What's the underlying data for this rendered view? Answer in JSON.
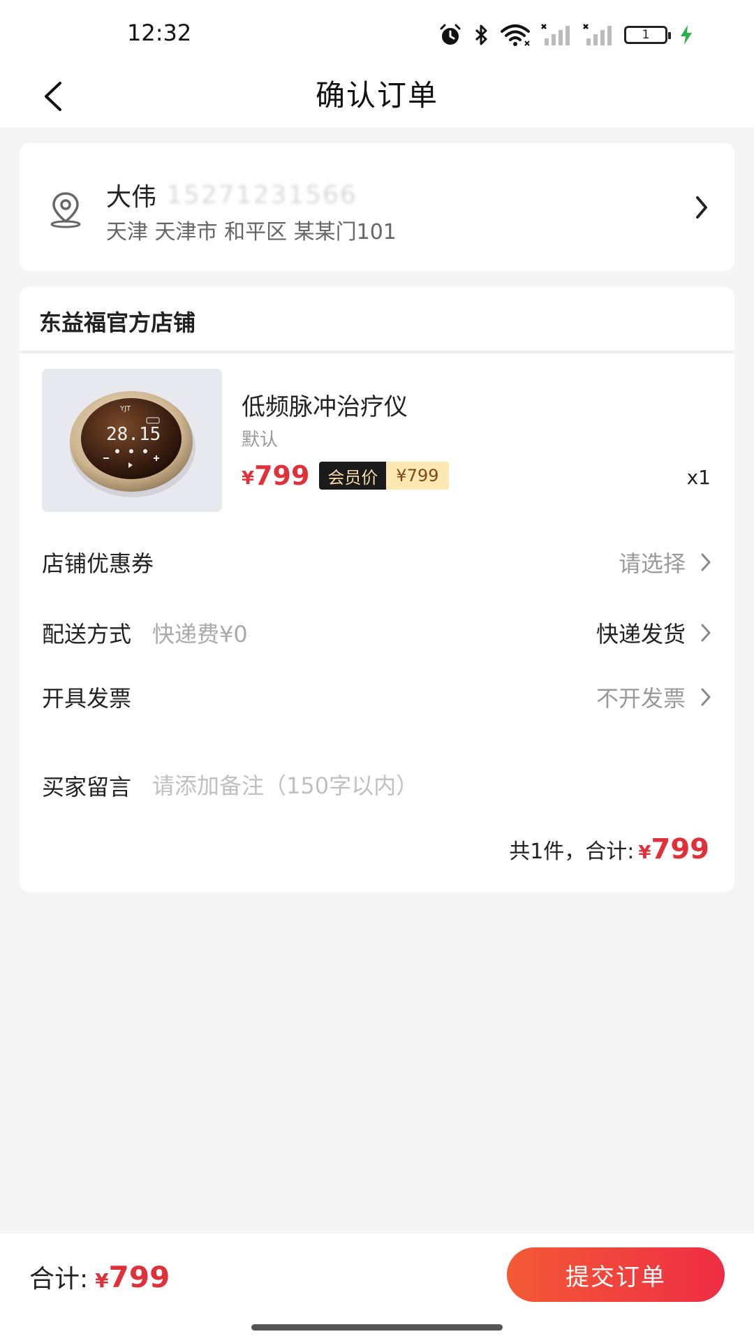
{
  "status_bar": {
    "time": "12:32",
    "battery_level": "1",
    "icons": [
      "alarm-icon",
      "bluetooth-icon",
      "wifi-icon",
      "signal-icon",
      "signal-icon",
      "battery-icon",
      "charging-icon"
    ],
    "charging_color": "#2bb24c"
  },
  "nav": {
    "title": "确认订单",
    "back_icon": "chevron-left-icon"
  },
  "address": {
    "name": "大伟",
    "phone": "15271231566",
    "detail": "天津 天津市 和平区 某某门101",
    "icon": "location-pin-icon"
  },
  "shop": {
    "name": "东益福官方店铺"
  },
  "product": {
    "image_brand": "YJT",
    "image_display": "28.15",
    "name": "低频脉冲治疗仪",
    "spec": "默认",
    "price_symbol": "¥",
    "price": "799",
    "member_label": "会员价",
    "member_price": "¥799",
    "quantity": "x1"
  },
  "rows": {
    "coupon": {
      "label": "店铺优惠券",
      "value": "请选择"
    },
    "delivery": {
      "label": "配送方式",
      "sub": "快递费¥0",
      "value": "快递发货"
    },
    "invoice": {
      "label": "开具发票",
      "value": "不开发票"
    },
    "remark": {
      "label": "买家留言",
      "placeholder": "请添加备注（150字以内）",
      "value": ""
    }
  },
  "summary": {
    "text": "共1件，合计:",
    "price_symbol": "¥",
    "price": "799"
  },
  "bottom": {
    "total_label": "合计:",
    "price_symbol": "¥",
    "price": "799",
    "submit_label": "提交订单"
  },
  "colors": {
    "accent": "#e0303a",
    "submit_gradient_start": "#f35a35",
    "submit_gradient_end": "#ee2d44",
    "member_dark": "#1a1a1a",
    "member_light": "#fde7b3"
  }
}
